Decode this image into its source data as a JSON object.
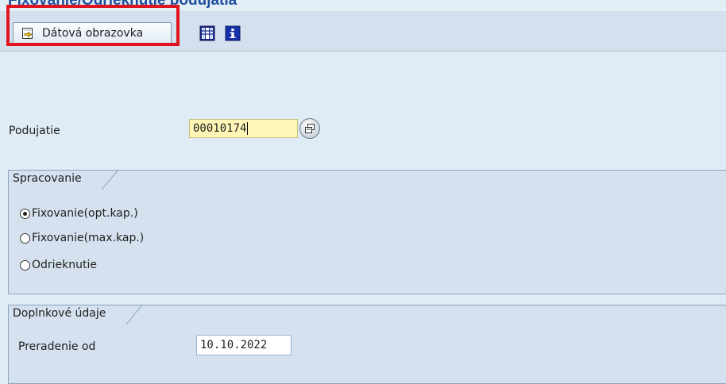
{
  "window": {
    "title": "Fixovanie/Odrieknutie podujatia"
  },
  "toolbar": {
    "data_screen_label": "Dátová obrazovka",
    "icons": [
      "execute-icon",
      "table-layout-icon",
      "info-icon"
    ]
  },
  "event": {
    "label": "Podujatie",
    "value": "00010174"
  },
  "processing": {
    "title": "Spracovanie",
    "options": [
      {
        "label": "Fixovanie(opt.kap.)",
        "selected": true
      },
      {
        "label": "Fixovanie(max.kap.)",
        "selected": false
      },
      {
        "label": "Odrieknutie",
        "selected": false
      }
    ]
  },
  "additional": {
    "title": "Doplnkové údaje",
    "rebooking_label": "Preradenie od",
    "rebooking_value": "10.10.2022"
  },
  "colors": {
    "highlight": "#e0141e",
    "title": "#1f4f9c",
    "required_field": "#fff6b7"
  }
}
